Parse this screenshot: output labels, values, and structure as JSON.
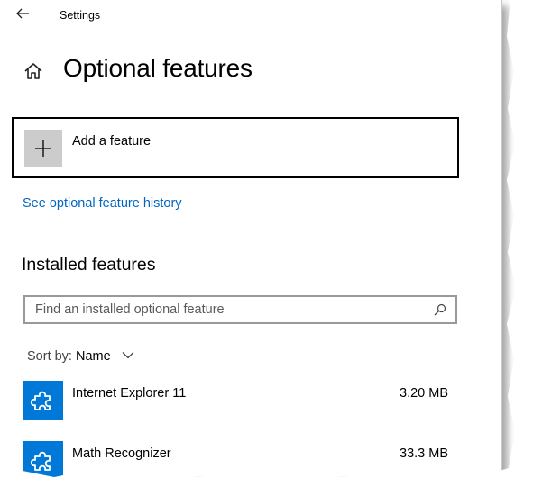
{
  "window": {
    "title": "Settings"
  },
  "page": {
    "title": "Optional features"
  },
  "add_feature": {
    "label": "Add a feature"
  },
  "history_link": {
    "label": "See optional feature history"
  },
  "installed": {
    "heading": "Installed features",
    "search_placeholder": "Find an installed optional feature",
    "sort_label": "Sort by:",
    "sort_value": "Name",
    "items": [
      {
        "name": "Internet Explorer 11",
        "size": "3.20 MB",
        "icon": "puzzle-piece-icon"
      },
      {
        "name": "Math Recognizer",
        "size": "33.3 MB",
        "icon": "puzzle-piece-icon"
      }
    ]
  },
  "colors": {
    "accent": "#0078d7",
    "link": "#0067c0",
    "tile_gray": "#cccccc"
  }
}
